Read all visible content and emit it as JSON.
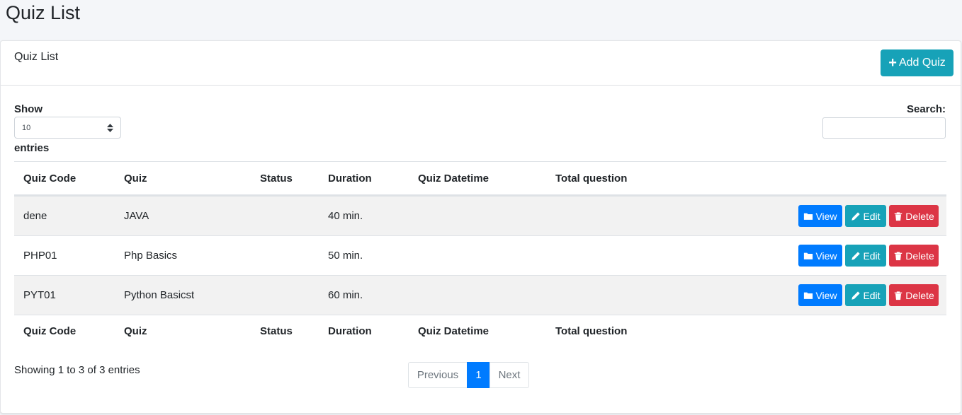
{
  "page": {
    "title": "Quiz List"
  },
  "card": {
    "title": "Quiz List",
    "add_button": "Add Quiz"
  },
  "controls": {
    "show_label": "Show",
    "page_length": "10",
    "entries_label": "entries",
    "search_label": "Search:",
    "search_value": ""
  },
  "table": {
    "columns": [
      "Quiz Code",
      "Quiz",
      "Status",
      "Duration",
      "Quiz Datetime",
      "Total question"
    ],
    "rows": [
      {
        "code": "dene",
        "quiz": "JAVA",
        "status": "",
        "duration": "40 min.",
        "datetime": "",
        "total": ""
      },
      {
        "code": "PHP01",
        "quiz": "Php Basics",
        "status": "",
        "duration": "50 min.",
        "datetime": "",
        "total": ""
      },
      {
        "code": "PYT01",
        "quiz": "Python Basicst",
        "status": "",
        "duration": "60 min.",
        "datetime": "",
        "total": ""
      }
    ],
    "actions": {
      "view": "View",
      "edit": "Edit",
      "delete": "Delete"
    }
  },
  "footer": {
    "info": "Showing 1 to 3 of 3 entries",
    "pagination": {
      "previous": "Previous",
      "current": "1",
      "next": "Next"
    }
  },
  "colors": {
    "primary": "#007bff",
    "info": "#17a2b8",
    "danger": "#dc3545"
  }
}
